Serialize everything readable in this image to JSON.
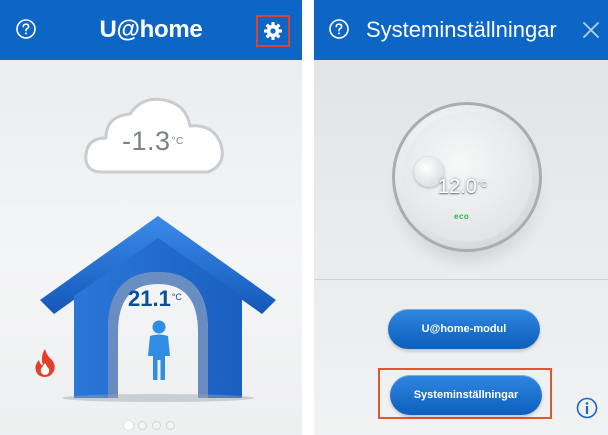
{
  "left_screen": {
    "app_title": "U@home",
    "outdoor_temp": "-1.3",
    "outdoor_unit": "°C",
    "indoor_temp": "21.1",
    "indoor_unit": "°C",
    "icons": {
      "help": "help-circle-icon",
      "settings": "gear-icon",
      "heating": "flame-icon",
      "weather": "cloud-icon",
      "house": "house-icon",
      "person": "person-icon"
    },
    "page_indicator": {
      "count": 4,
      "active": 1
    }
  },
  "right_screen": {
    "title": "Systeminställningar",
    "thermostat_temp": "12.0",
    "thermostat_unit": "°C",
    "eco_label": "eco",
    "buttons": {
      "module": "U@home-modul",
      "system_settings": "Systeminställningar"
    },
    "icons": {
      "help": "help-circle-icon",
      "close": "close-icon",
      "info": "info-icon",
      "thermostat": "thermostat-dial-icon"
    }
  },
  "colors": {
    "header_blue": "#0d66c6",
    "house_blue": "#1f6fd6",
    "highlight_orange": "#e0582c",
    "eco_green": "#2eb34a",
    "flame_red": "#e2402b"
  }
}
